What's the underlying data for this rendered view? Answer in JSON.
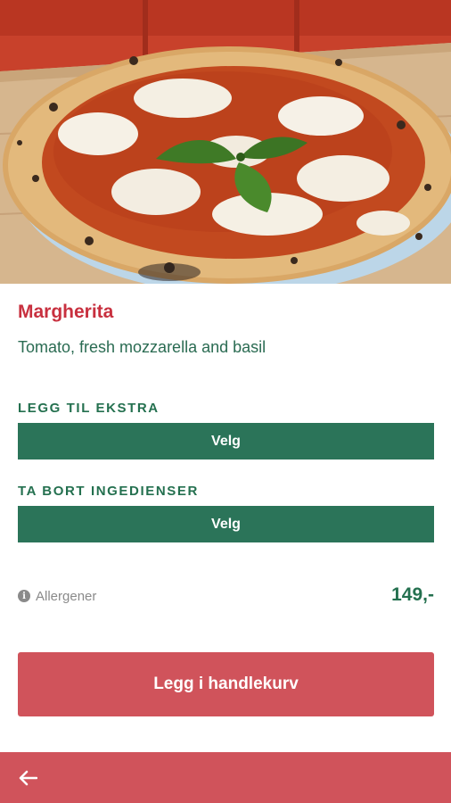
{
  "product": {
    "title": "Margherita",
    "description": "Tomato, fresh mozzarella and basil",
    "price": "149,-"
  },
  "extras": {
    "label": "LEGG TIL EKSTRA",
    "button_label": "Velg"
  },
  "remove_ingredients": {
    "label": "TA BORT INGEDIENSER",
    "button_label": "Velg"
  },
  "allergens": {
    "icon": "info-icon",
    "glyph": "i",
    "label": "Allergener"
  },
  "cart": {
    "button_label": "Legg i handlekurv"
  },
  "nav": {
    "back_icon": "arrow-left-icon"
  },
  "colors": {
    "title": "#c8303f",
    "accent_green": "#2b7459",
    "accent_red": "#d0535b"
  }
}
